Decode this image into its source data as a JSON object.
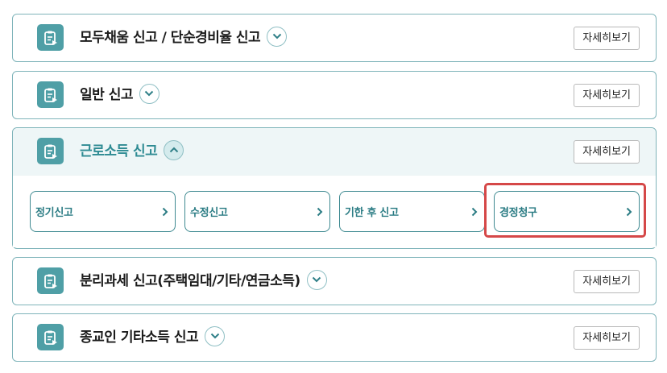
{
  "sections": [
    {
      "title": "모두채움 신고 / 단순경비율 신고",
      "detail_label": "자세히보기",
      "expanded": false
    },
    {
      "title": "일반 신고",
      "detail_label": "자세히보기",
      "expanded": false
    },
    {
      "title": "근로소득 신고",
      "detail_label": "자세히보기",
      "expanded": true,
      "items": [
        {
          "label": "정기신고"
        },
        {
          "label": "수정신고"
        },
        {
          "label": "기한 후 신고"
        },
        {
          "label": "경정청구"
        }
      ]
    },
    {
      "title": "분리과세 신고(주택임대/기타/연금소득)",
      "detail_label": "자세히보기",
      "expanded": false
    },
    {
      "title": "종교인 기타소득 신고",
      "detail_label": "자세히보기",
      "expanded": false
    }
  ],
  "colors": {
    "accent": "#4f9fa6",
    "active_title": "#2e8b93",
    "border": "#7fb4ba",
    "highlight": "#d54848"
  },
  "icons": {
    "section": "document-edit-icon",
    "collapsed": "chevron-down-icon",
    "expanded": "chevron-up-icon",
    "item": "chevron-right-icon"
  }
}
